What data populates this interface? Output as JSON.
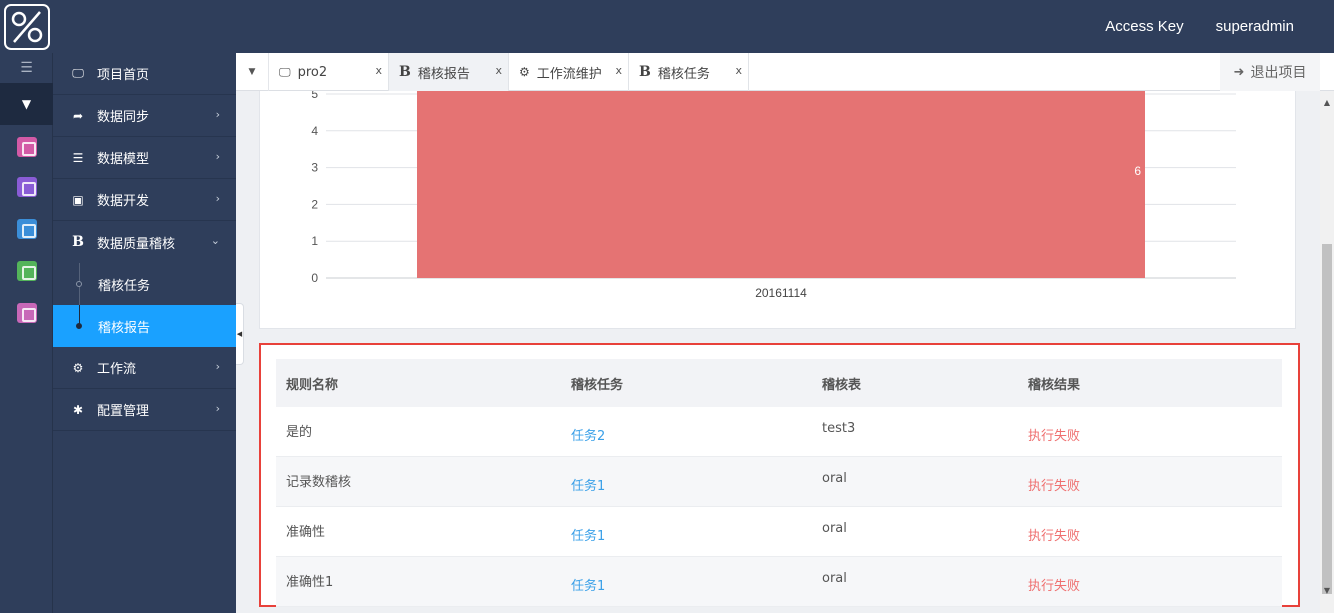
{
  "header": {
    "access_key": "Access Key",
    "user": "superadmin"
  },
  "rail": {
    "menu_icon": "list-icon",
    "toggle_icon": "caret-down-icon",
    "apps": [
      {
        "icon": "app-icon-1",
        "color": "#d35aa6"
      },
      {
        "icon": "app-icon-2",
        "color": "#8a5cd6"
      },
      {
        "icon": "app-icon-3",
        "color": "#3b8ed8"
      },
      {
        "icon": "app-icon-4",
        "color": "#54b45a"
      },
      {
        "icon": "app-icon-5",
        "color": "#c868b8"
      }
    ]
  },
  "sidebar": {
    "items": [
      {
        "label": "项目首页",
        "icon": "monitor-icon"
      },
      {
        "label": "数据同步",
        "icon": "share-icon"
      },
      {
        "label": "数据模型",
        "icon": "database-icon"
      },
      {
        "label": "数据开发",
        "icon": "file-code-icon"
      },
      {
        "label": "数据质量稽核",
        "icon": "bold-b-icon"
      },
      {
        "label": "工作流",
        "icon": "gears-icon"
      },
      {
        "label": "配置管理",
        "icon": "gear-icon"
      }
    ],
    "sub_items": [
      {
        "label": "稽核任务"
      },
      {
        "label": "稽核报告"
      }
    ]
  },
  "tabs": [
    {
      "label": "pro2",
      "icon": "monitor-icon",
      "close": "x"
    },
    {
      "label": "稽核报告",
      "icon": "bold-b-icon",
      "close": "x"
    },
    {
      "label": "工作流维护",
      "icon": "gears-icon",
      "close": "x"
    },
    {
      "label": "稽核任务",
      "icon": "bold-b-icon",
      "close": "x"
    }
  ],
  "exit_label": "退出项目",
  "chart_data": {
    "type": "bar",
    "categories": [
      "20161114"
    ],
    "values": [
      6
    ],
    "data_labels": [
      "6"
    ],
    "yticks": [
      "0",
      "1",
      "2",
      "3",
      "4",
      "5"
    ],
    "ylim": [
      0,
      5
    ],
    "grid": true,
    "color": "#e57373"
  },
  "table": {
    "headers": [
      "规则名称",
      "稽核任务",
      "稽核表",
      "稽核结果"
    ],
    "rows": [
      [
        "是的",
        "任务2",
        "test3",
        "执行失败"
      ],
      [
        "记录数稽核",
        "任务1",
        "oral",
        "执行失败"
      ],
      [
        "准确性",
        "任务1",
        "oral",
        "执行失败"
      ],
      [
        "准确性1",
        "任务1",
        "oral",
        "执行失败"
      ]
    ]
  },
  "colors": {
    "nav_bg": "#2f3e5b",
    "active_blue": "#1aa1ff",
    "link_blue": "#3aa0e8",
    "fail_red": "#ef6f6f",
    "highlight_border": "#e8413a"
  }
}
